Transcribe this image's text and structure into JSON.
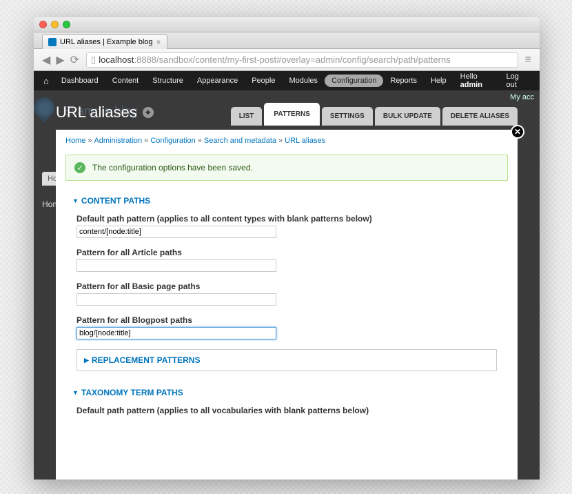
{
  "browser": {
    "tab_title": "URL aliases | Example blog",
    "url_host": "localhost",
    "url_path": ":8888/sandbox/content/my-first-post#overlay=admin/config/search/path/patterns"
  },
  "toolbar": {
    "items": [
      "Dashboard",
      "Content",
      "Structure",
      "Appearance",
      "People",
      "Modules",
      "Configuration",
      "Reports",
      "Help"
    ],
    "active": "Configuration",
    "hello_prefix": "Hello ",
    "hello_user": "admin",
    "logout": "Log out"
  },
  "background": {
    "site_title": "Example blog",
    "tab1": "Ho",
    "tab2": "Hom",
    "myacc": "My acc"
  },
  "overlay": {
    "title": "URL aliases",
    "tabs": [
      "LIST",
      "PATTERNS",
      "SETTINGS",
      "BULK UPDATE",
      "DELETE ALIASES"
    ],
    "active_tab": "PATTERNS"
  },
  "breadcrumbs": [
    {
      "text": "Home",
      "link": true
    },
    {
      "text": "Administration",
      "link": true
    },
    {
      "text": "Configuration",
      "link": true
    },
    {
      "text": "Search and metadata",
      "link": true
    },
    {
      "text": "URL aliases",
      "link": true
    }
  ],
  "status": "The configuration options have been saved.",
  "sections": {
    "content_paths": {
      "title": "CONTENT PATHS",
      "default_label": "Default path pattern (applies to all content types with blank patterns below)",
      "default_value": "content/[node:title]",
      "article_label": "Pattern for all Article paths",
      "article_value": "",
      "basic_label": "Pattern for all Basic page paths",
      "basic_value": "",
      "blogpost_label": "Pattern for all Blogpost paths",
      "blogpost_value": "blog/[node:title]",
      "replacement_title": "REPLACEMENT PATTERNS"
    },
    "taxonomy": {
      "title": "TAXONOMY TERM PATHS",
      "default_label": "Default path pattern (applies to all vocabularies with blank patterns below)"
    }
  }
}
